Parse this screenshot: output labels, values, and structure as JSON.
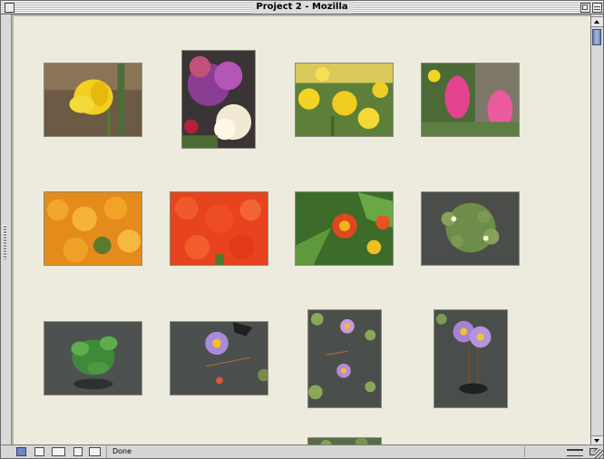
{
  "window": {
    "title": "Project 2 - Mozilla"
  },
  "gallery": {
    "thumbnails": [
      {
        "subject": "yellow daffodil"
      },
      {
        "subject": "purple and white chrysanthemums"
      },
      {
        "subject": "yellow daffodils bed"
      },
      {
        "subject": "pink hyacinths"
      },
      {
        "subject": "orange tulips field"
      },
      {
        "subject": "red tulips field"
      },
      {
        "subject": "red and orange blossoms with green leaves"
      },
      {
        "subject": "lily pads with white flowers"
      },
      {
        "subject": "green plant in dark water"
      },
      {
        "subject": "purple water lily"
      },
      {
        "subject": "water lilies on pond"
      },
      {
        "subject": "purple water lilies with stems"
      },
      {
        "subject": "partially visible thumbnail"
      }
    ]
  },
  "statusbar": {
    "status_text": "Done"
  },
  "icons": {
    "navigator": "navigator-icon",
    "mail": "mail-icon",
    "composer": "composer-icon",
    "address_book": "address-book-icon",
    "chat": "chat-icon",
    "connection": "connection-icon",
    "security": "lock-icon"
  },
  "colors": {
    "page_background": "#edebdd",
    "chrome": "#dcdcdc",
    "scroll_thumb": "#6d7fb0"
  }
}
